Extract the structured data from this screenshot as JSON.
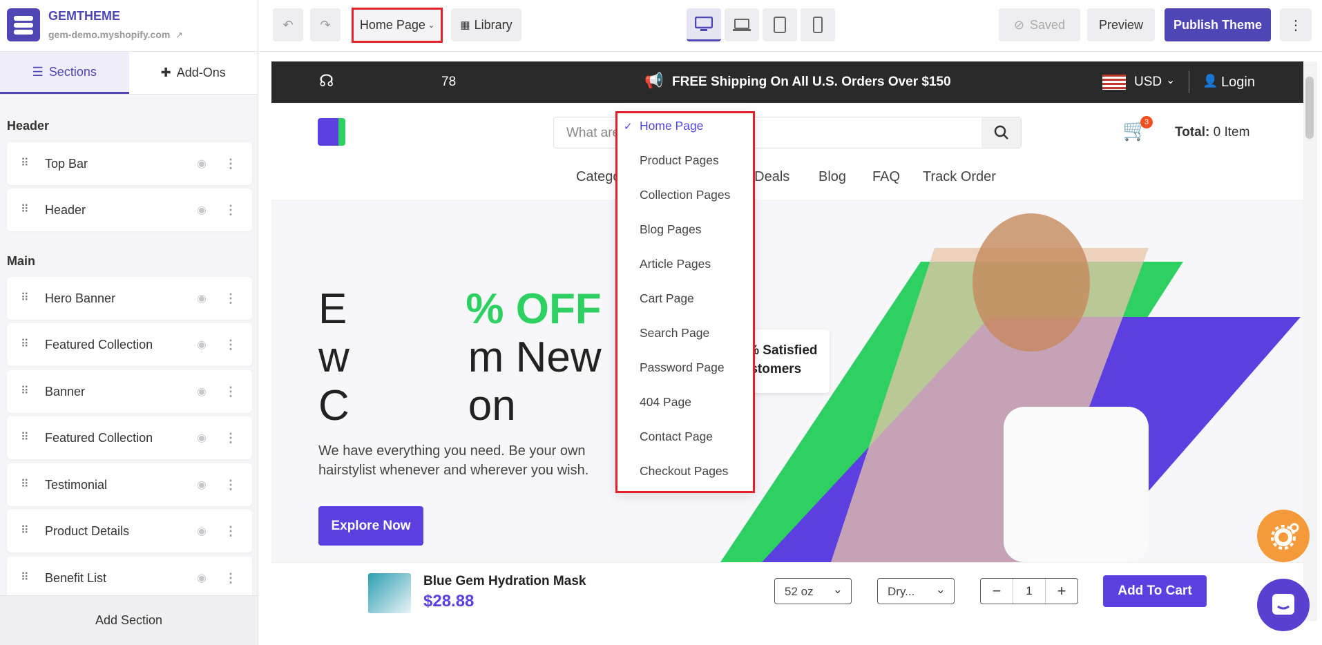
{
  "brand": {
    "name": "GEMTHEME",
    "url": "gem-demo.myshopify.com"
  },
  "panel_tabs": {
    "sections": "Sections",
    "addons": "Add-Ons"
  },
  "groups": {
    "header": "Header",
    "main": "Main"
  },
  "sections": [
    "Top Bar",
    "Header",
    "Hero Banner",
    "Featured Collection",
    "Banner",
    "Featured Collection",
    "Testimonial",
    "Product Details",
    "Benefit List"
  ],
  "add_section": "Add Section",
  "toolbar": {
    "page_select": "Home Page",
    "library": "Library",
    "saved": "Saved",
    "preview": "Preview",
    "publish": "Publish Theme"
  },
  "page_menu": [
    "Home Page",
    "Product Pages",
    "Collection Pages",
    "Blog Pages",
    "Article Pages",
    "Cart Page",
    "Search Page",
    "Password Page",
    "404 Page",
    "Contact Page",
    "Checkout Pages"
  ],
  "store": {
    "phone_suffix": "78",
    "shipping": "FREE Shipping On All U.S. Orders Over $150",
    "currency": "USD",
    "login": "Login",
    "search_placeholder": "What are you looking for?",
    "cart_count": "3",
    "total_label": "Total:",
    "total_value": "0 Item",
    "nav": [
      "Categories",
      "Today’s Deals",
      "Blog",
      "FAQ",
      "Track Order"
    ],
    "hero_title_a": "E",
    "hero_title_b": "% OFF",
    "hero_title_c": "w",
    "hero_title_d": "m New",
    "hero_title_e": "C",
    "hero_title_f": "on",
    "hero_sub": "We have everything you need. Be your own hairstylist whenever and wherever you wish.",
    "explore": "Explore Now",
    "satisfied_1": "96% Satisfied",
    "satisfied_2": "Customers",
    "product_name": "Blue Gem Hydration Mask",
    "product_price": "$28.88",
    "size": "52 oz",
    "variant": "Dry...",
    "qty": "1",
    "add_to_cart": "Add To Cart"
  },
  "colors": {
    "accent": "#4f46b6",
    "highlight": "#e5202a",
    "promo": "#2ed161",
    "button": "#5b3fe0"
  }
}
